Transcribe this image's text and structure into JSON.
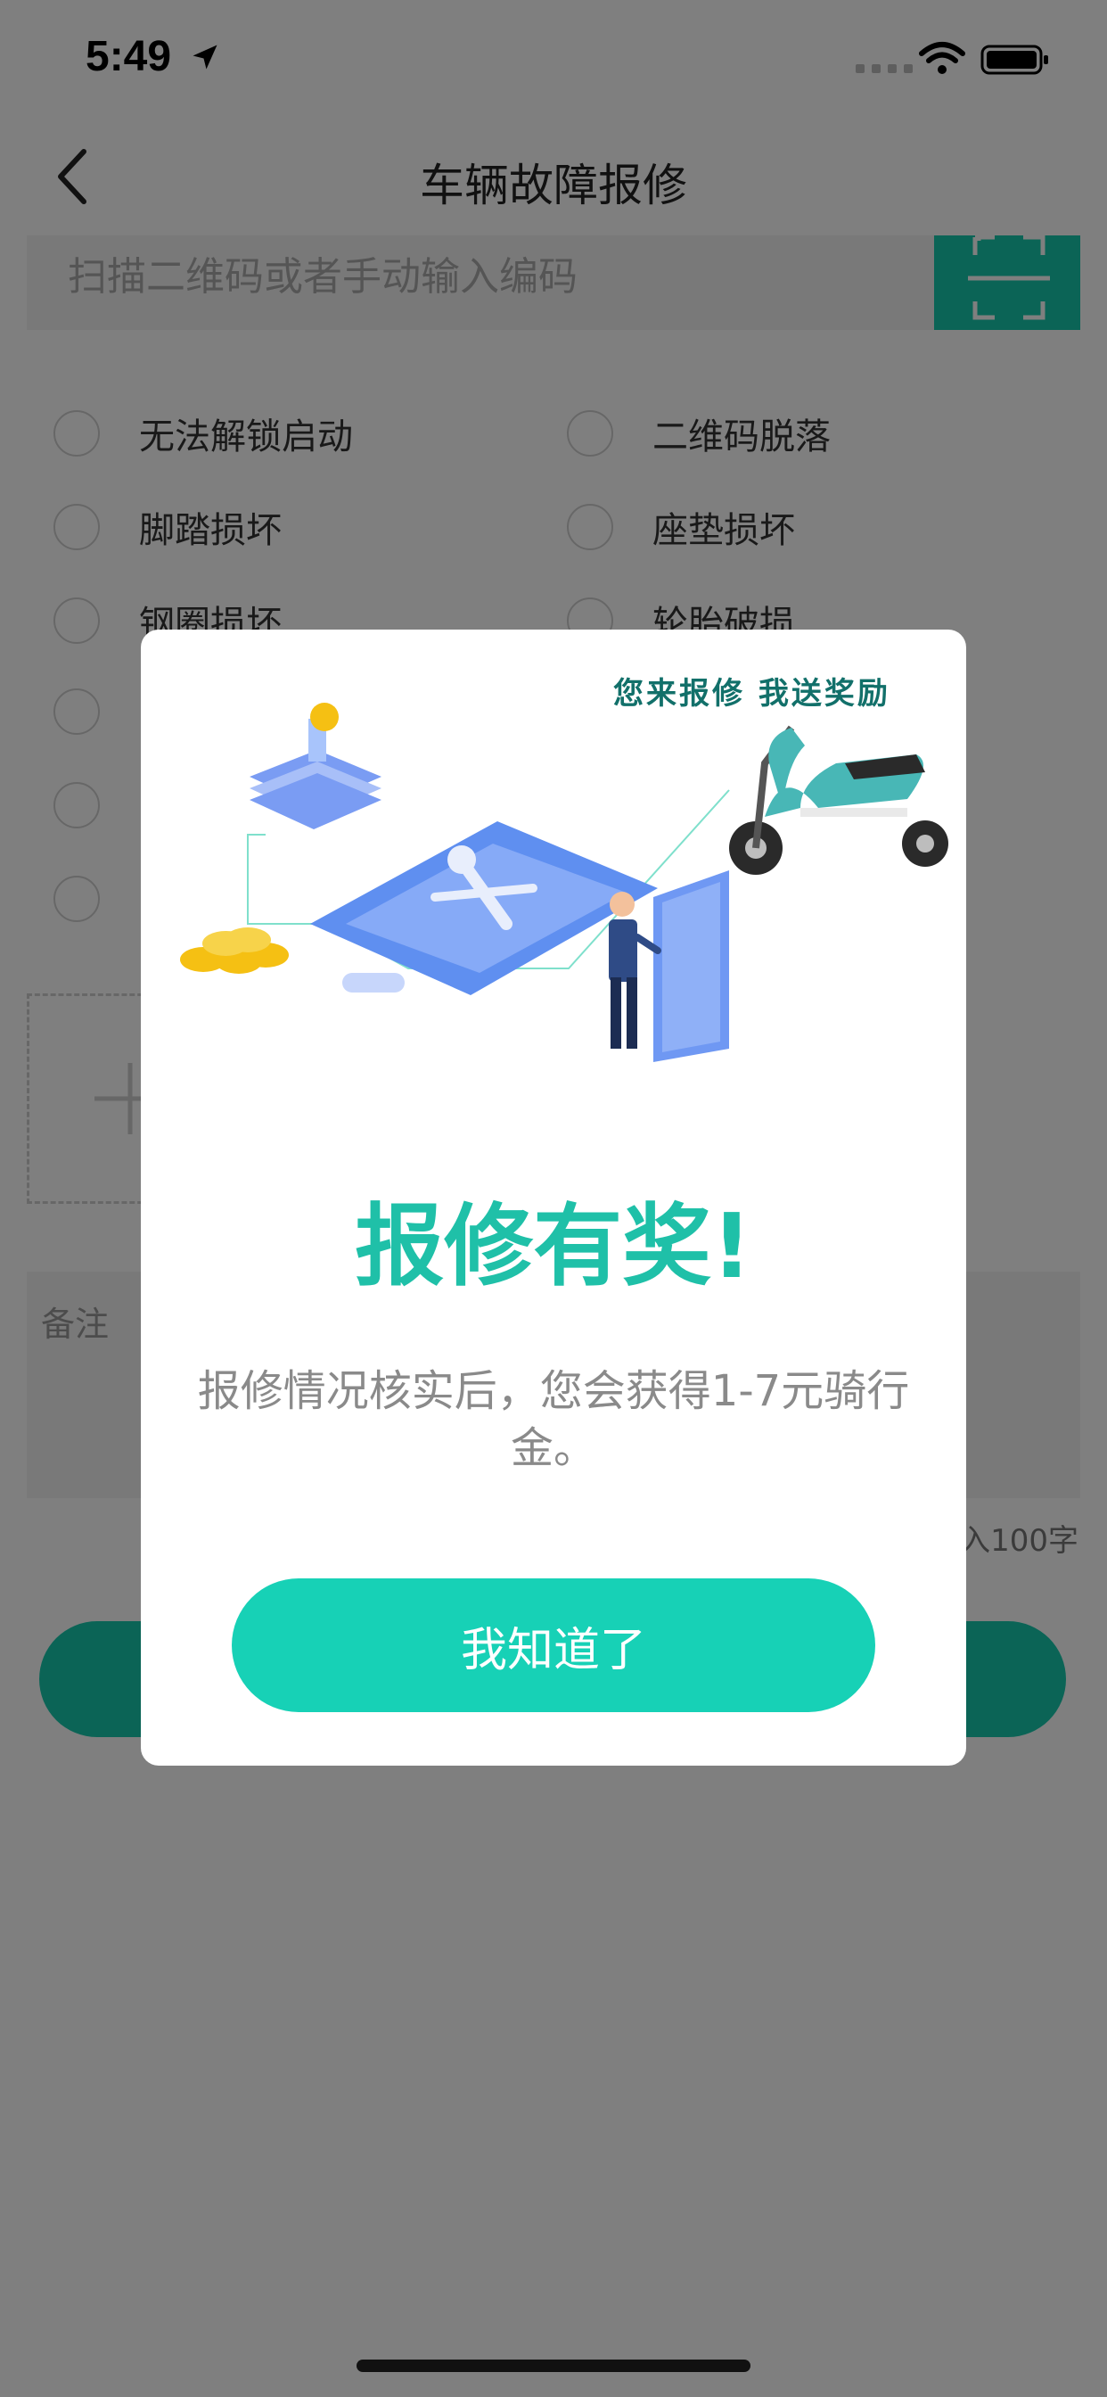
{
  "status_bar": {
    "time": "5:49"
  },
  "nav": {
    "title": "车辆故障报修"
  },
  "scan": {
    "placeholder": "扫描二维码或者手动输入编码"
  },
  "fault_options": [
    "无法解锁启动",
    "二维码脱落",
    "脚踏损坏",
    "座垫损坏",
    "钢圈损坏",
    "轮胎破损"
  ],
  "remark": {
    "placeholder": "备注",
    "limit_hint": "入100字"
  },
  "modal": {
    "slogan": "您来报修  我送奖励",
    "title": "报修有奖!",
    "description": "报修情况核实后，您会获得1-7元骑行金。",
    "ok_label": "我知道了"
  },
  "colors": {
    "accent": "#17C9AD",
    "title_teal": "#1FC0A8",
    "slogan_teal": "#12706A",
    "overlay": "rgba(0,0,0,0.5)"
  }
}
